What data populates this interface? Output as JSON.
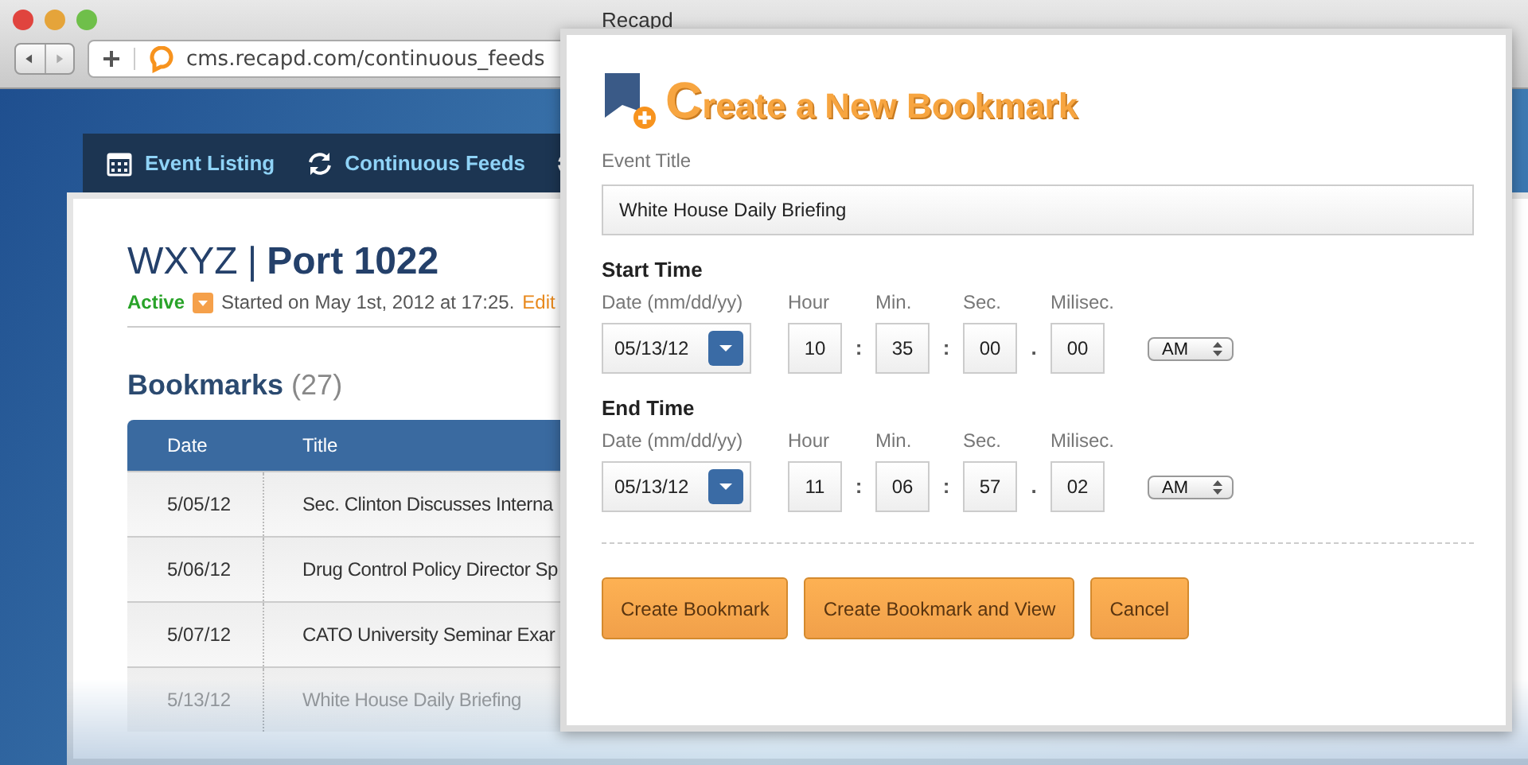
{
  "browser": {
    "title": "Recapd",
    "url": "cms.recapd.com/continuous_feeds"
  },
  "nav": [
    {
      "label": "Event Listing"
    },
    {
      "label": "Continuous Feeds"
    }
  ],
  "feed": {
    "station": "WXYZ",
    "separator": "|",
    "port": "Port 1022",
    "status": "Active",
    "started": "Started on May 1st, 2012 at 17:25.",
    "edit_link": "Edit"
  },
  "bookmarks": {
    "heading": "Bookmarks",
    "count": "(27)",
    "columns": [
      "Date",
      "Title"
    ],
    "rows": [
      {
        "date": "5/05/12",
        "title": "Sec. Clinton Discusses Interna",
        "faded": false
      },
      {
        "date": "5/06/12",
        "title": "Drug Control Policy Director Sp",
        "faded": false
      },
      {
        "date": "5/07/12",
        "title": "CATO University Seminar Exar",
        "faded": false
      },
      {
        "date": "5/13/12",
        "title": "White House Daily Briefing",
        "faded": true
      }
    ]
  },
  "dialog": {
    "title_first": "C",
    "title_rest": "reate a New Bookmark",
    "event_title_label": "Event Title",
    "event_title_value": "White House Daily Briefing",
    "sections": [
      {
        "heading": "Start Time",
        "date_label": "Date (mm/dd/yy)",
        "date": "05/13/12",
        "parts": [
          {
            "label": "Hour",
            "value": "10",
            "sep": ":"
          },
          {
            "label": "Min.",
            "value": "35",
            "sep": ":"
          },
          {
            "label": "Sec.",
            "value": "00",
            "sep": "."
          },
          {
            "label": "Milisec.",
            "value": "00"
          }
        ],
        "ampm": "AM"
      },
      {
        "heading": "End Time",
        "date_label": "Date (mm/dd/yy)",
        "date": "05/13/12",
        "parts": [
          {
            "label": "Hour",
            "value": "11",
            "sep": ":"
          },
          {
            "label": "Min.",
            "value": "06",
            "sep": ":"
          },
          {
            "label": "Sec.",
            "value": "57",
            "sep": "."
          },
          {
            "label": "Milisec.",
            "value": "02"
          }
        ],
        "ampm": "AM"
      }
    ],
    "buttons": [
      "Create Bookmark",
      "Create Bookmark and View",
      "Cancel"
    ]
  }
}
